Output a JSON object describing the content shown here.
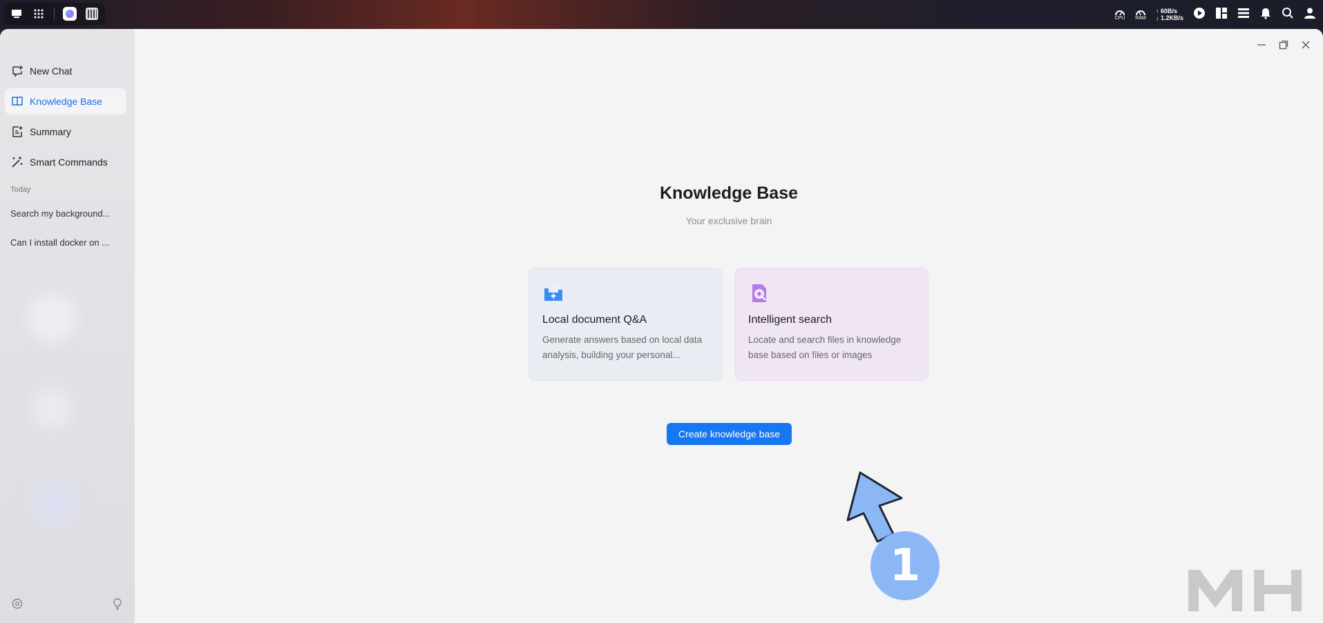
{
  "sidebar": {
    "items": [
      {
        "label": "New Chat",
        "icon": "new-chat-icon"
      },
      {
        "label": "Knowledge Base",
        "icon": "book-icon",
        "active": true
      },
      {
        "label": "Summary",
        "icon": "summary-icon"
      },
      {
        "label": "Smart Commands",
        "icon": "magic-wand-icon"
      }
    ],
    "section_today": "Today",
    "history": [
      "Search my background...",
      "Can I install docker on ..."
    ]
  },
  "tray": {
    "cpu_label": "CPU",
    "ram_label": "RAM",
    "net_up": "↑ 60B/s",
    "net_down": "↓ 1.2KB/s"
  },
  "main": {
    "title": "Knowledge Base",
    "subtitle": "Your exclusive brain",
    "cards": [
      {
        "title": "Local document Q&A",
        "desc": "Generate answers based on local data analysis, building your personal..."
      },
      {
        "title": "Intelligent search",
        "desc": "Locate and search files in knowledge base based on files or images"
      }
    ],
    "create_button": "Create knowledge base"
  },
  "annotation": {
    "step": "1"
  },
  "colors": {
    "accent": "#1677f2",
    "annotation": "#8cb7f5",
    "active_text": "#1a6fe0"
  }
}
